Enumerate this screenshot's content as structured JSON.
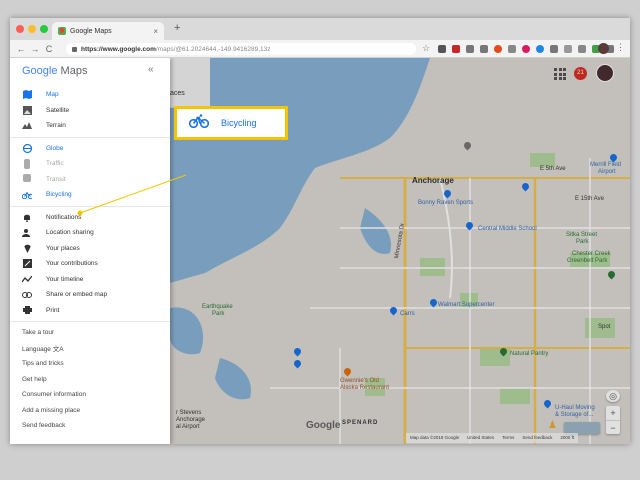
{
  "browser": {
    "tab_title": "Google Maps",
    "tab_close": "×",
    "new_tab": "+",
    "url_host": "https://www.google.com",
    "url_path": "/maps/@61.2024644,-149.9416289,13z",
    "back": "←",
    "forward": "→",
    "reload": "C",
    "star": "☆",
    "menu": "⋮"
  },
  "sidebar": {
    "logo_google": "Google",
    "logo_maps": " Maps",
    "collapse": "«",
    "map_types": [
      {
        "label": "Map",
        "icon": "map-icon"
      },
      {
        "label": "Satellite",
        "icon": "satellite-icon"
      },
      {
        "label": "Terrain",
        "icon": "terrain-icon"
      }
    ],
    "layers": [
      {
        "label": "Globe",
        "icon": "globe-icon"
      },
      {
        "label": "Traffic",
        "icon": "traffic-icon"
      },
      {
        "label": "Transit",
        "icon": "transit-icon"
      },
      {
        "label": "Bicycling",
        "icon": "bicycle-icon"
      }
    ],
    "tools": [
      {
        "label": "Notifications",
        "icon": "bell-icon"
      },
      {
        "label": "Location sharing",
        "icon": "location-sharing-icon"
      },
      {
        "label": "Your places",
        "icon": "pin-icon"
      },
      {
        "label": "Your contributions",
        "icon": "edit-icon"
      },
      {
        "label": "Your timeline",
        "icon": "timeline-icon"
      },
      {
        "label": "Share or embed map",
        "icon": "link-icon"
      },
      {
        "label": "Print",
        "icon": "print-icon"
      }
    ],
    "links": [
      {
        "label": "Take a tour"
      },
      {
        "label": "Language 文A"
      },
      {
        "label": "Tips and tricks"
      },
      {
        "label": "Get help"
      },
      {
        "label": "Consumer information"
      },
      {
        "label": "Add a missing place"
      },
      {
        "label": "Send feedback"
      }
    ]
  },
  "callout": {
    "label": "Bicycling"
  },
  "map": {
    "notif_count": "21",
    "places_stub": "aces",
    "labels": {
      "anchorage": "Anchorage",
      "merrill": "Merrill Field\nAirport",
      "merrill_1": "Merrill Field",
      "merrill_2": "Airport",
      "bonny": "Bonny Raven Sports",
      "central": "Central Middle School",
      "sitka": "Sitka Street\nPark",
      "sitka_1": "Sitka Street",
      "sitka_2": "Park",
      "chester_1": "Chester Creek",
      "chester_2": "Greenbelt Park",
      "earthquake_1": "Earthquake",
      "earthquake_2": "Park",
      "carrs": "Carrs",
      "walmart": "Walmart Supercenter",
      "natural": "Natural Pantry",
      "gwennies_1": "Gwennie's Old",
      "gwennies_2": "Alaska Restaurant",
      "stevens_1": "r Stevens",
      "stevens_2": "Anchorage",
      "stevens_3": "al Airport",
      "uhaul_1": "U-Haul Moving",
      "uhaul_2": "& Storage of...",
      "spenard": "SPENARD",
      "e5th": "E 5th Ave",
      "e15th": "E 15th Ave",
      "minnesota": "Minnesota Dr",
      "google": "Google",
      "spot": "Spot"
    },
    "zoom_in": "+",
    "zoom_out": "−",
    "footer": [
      "Map data ©2018 Google",
      "United States",
      "Terms",
      "Send feedback",
      "2000 ft"
    ]
  },
  "colors": {
    "accent": "#1a73e8",
    "callout_border": "#f2c500",
    "water": "#8ab4d8",
    "park": "#b6d7a0"
  }
}
